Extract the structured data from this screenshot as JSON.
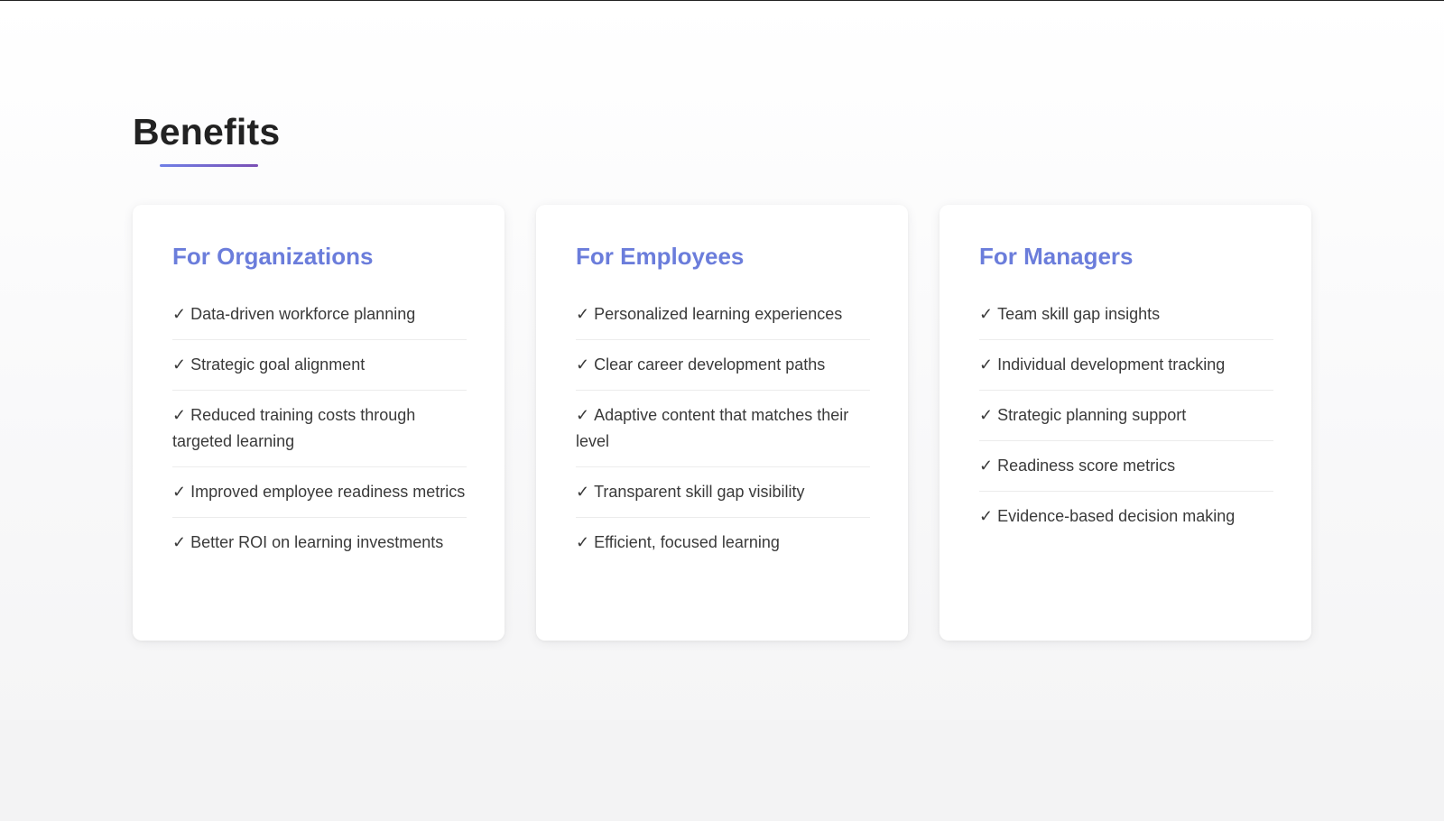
{
  "page": {
    "title": "Benefits"
  },
  "cards": [
    {
      "title": "For Organizations",
      "items": [
        "Data-driven workforce planning",
        "Strategic goal alignment",
        "Reduced training costs through targeted learning",
        "Improved employee readiness metrics",
        "Better ROI on learning investments"
      ]
    },
    {
      "title": "For Employees",
      "items": [
        "Personalized learning experiences",
        "Clear career development paths",
        "Adaptive content that matches their level",
        "Transparent skill gap visibility",
        "Efficient, focused learning"
      ]
    },
    {
      "title": "For Managers",
      "items": [
        "Team skill gap insights",
        "Individual development tracking",
        "Strategic planning support",
        "Readiness score metrics",
        "Evidence-based decision making"
      ]
    }
  ],
  "check_mark": "✓",
  "colors": {
    "card_title": "#6b7ddb",
    "underline_start": "#6f7fe6",
    "underline_end": "#7a4fb5"
  }
}
